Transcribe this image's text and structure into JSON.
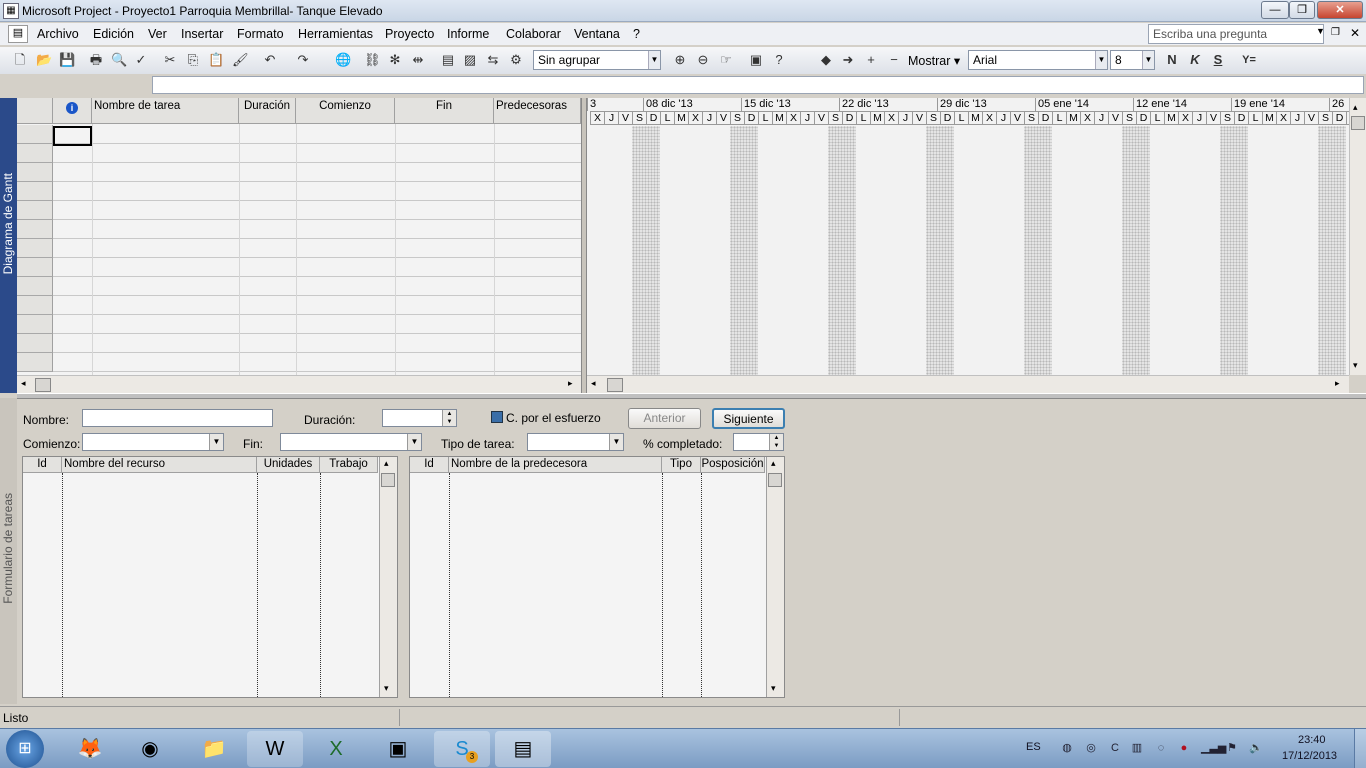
{
  "window": {
    "title": "Microsoft Project - Proyecto1 Parroquia Membrillal- Tanque Elevado",
    "controls": {
      "minimize": "—",
      "restore": "❐",
      "close": "✕"
    }
  },
  "menu": {
    "items": [
      "Archivo",
      "Edición",
      "Ver",
      "Insertar",
      "Formato",
      "Herramientas",
      "Proyecto",
      "Informe",
      "Colaborar",
      "Ventana",
      "?"
    ],
    "help_placeholder": "Escriba una pregunta"
  },
  "toolbar": {
    "group_value": "Sin agrupar",
    "show_label": "Mostrar",
    "font_value": "Arial",
    "size_value": "8",
    "bold": "N",
    "italic": "K",
    "underline": "S",
    "filter_icon": "Y="
  },
  "gantt": {
    "side_label": "Diagrama de Gantt",
    "columns": [
      "Nombre de tarea",
      "Duración",
      "Comienzo",
      "Fin",
      "Predecesoras"
    ],
    "info_icon": "i",
    "timescale": {
      "weeks": [
        "3",
        "08 dic '13",
        "15 dic '13",
        "22 dic '13",
        "29 dic '13",
        "05 ene '14",
        "12 ene '14",
        "19 ene '14",
        "26"
      ],
      "day_letters": [
        "X",
        "J",
        "V",
        "S",
        "D",
        "L",
        "M"
      ]
    }
  },
  "form": {
    "side_label": "Formulario de tareas",
    "name_label": "Nombre:",
    "duration_label": "Duración:",
    "effort_label": "C. por el esfuerzo",
    "prev_button": "Anterior",
    "next_button": "Siguiente",
    "start_label": "Comienzo:",
    "finish_label": "Fin:",
    "task_type_label": "Tipo de tarea:",
    "complete_label": "% completado:",
    "resources_columns": [
      "Id",
      "Nombre del recurso",
      "Unidades",
      "Trabajo"
    ],
    "predecessors_columns": [
      "Id",
      "Nombre de la predecesora",
      "Tipo",
      "Posposición"
    ]
  },
  "status": {
    "text": "Listo"
  },
  "taskbar": {
    "language": "ES",
    "time": "23:40",
    "date": "17/12/2013",
    "skype_badge": "3"
  }
}
